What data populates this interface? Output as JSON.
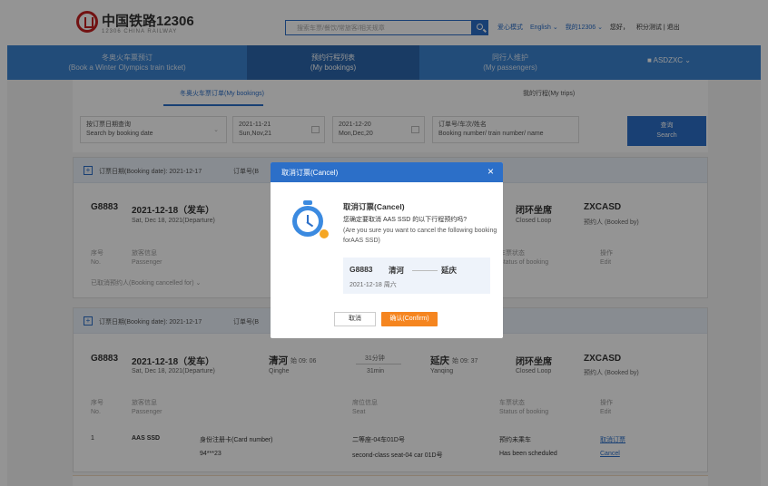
{
  "header": {
    "brand": "中国铁路12306",
    "brand_sub": "12306 CHINA RAILWAY",
    "search_placeholder": "搜索车票/餐饮/常旅客/相关规章",
    "links": [
      "爱心模式",
      "English ⌄",
      "我的12306 ⌄",
      "您好，"
    ],
    "user_links": "积分测试 | 退出"
  },
  "nav": {
    "items": [
      {
        "line1": "冬奥火车票预订",
        "line2": "(Book a Winter Olympics train ticket)"
      },
      {
        "line1": "预约行程列表",
        "line2": "(My bookings)"
      },
      {
        "line1": "同行人维护",
        "line2": "(My passengers)"
      }
    ],
    "user": "ASDZXC ⌄"
  },
  "tabs": {
    "tab1": "冬奥火车票订单(My bookings)",
    "tab2": "我的行程(My trips)"
  },
  "filter": {
    "type_line1": "按订票日期查询",
    "type_line2": "Search by booking date",
    "from_line1": "2021-11-21",
    "from_line2": "Sun,Nov,21",
    "to_line1": "2021-12-20",
    "to_line2": "Mon,Dec,20",
    "keyword_line1": "订单号/车次/姓名",
    "keyword_line2": "Booking number/ train number/ name",
    "query_line1": "查询",
    "query_line2": "Search"
  },
  "card1": {
    "booking_date": "订票日期(Booking date):  2021-12-17",
    "order_label": "订单号(B",
    "train": "G8883",
    "date": "2021-12-18（发车）",
    "date_en": "Sat,  Dec  18,  2021(Departure)",
    "seat_type": "闭环坐席",
    "seat_type_en": "Closed Loop",
    "booker": "ZXCASD",
    "booker_label": "预约人 (Booked by)",
    "col_no": "序号",
    "col_no_en": "No.",
    "col_passenger": "旅客信息",
    "col_passenger_en": "Passenger",
    "col_status": "车票状态",
    "col_status_en": "Status of booking",
    "col_action": "操作",
    "col_action_en": "Edit",
    "cancelled_toggle": "已取消预约人(Booking cancelled for) ⌄"
  },
  "card2": {
    "booking_date": "订票日期(Booking date):  2021-12-17",
    "order_label": "订单号(B",
    "train": "G8883",
    "date": "2021-12-18（发车）",
    "date_en": "Sat,  Dec  18,  2021(Departure)",
    "from_station": "清河",
    "from_time": "始 09: 06",
    "from_en": "Qinghe",
    "duration": "31分钟",
    "duration_en": "31min",
    "to_station": "延庆",
    "to_time": "始 09: 37",
    "to_en": "Yanqing",
    "seat_type": "闭环坐席",
    "seat_type_en": "Closed Loop",
    "booker": "ZXCASD",
    "booker_label": "预约人 (Booked by)",
    "col_no": "序号",
    "col_no_en": "No.",
    "col_passenger": "旅客信息",
    "col_passenger_en": "Passenger",
    "col_seat": "席位信息",
    "col_seat_en": "Seat",
    "col_status": "车票状态",
    "col_status_en": "Status of booking",
    "col_action": "操作",
    "col_action_en": "Edit",
    "row": {
      "no": "1",
      "name": "AAS SSD",
      "id_label": "身份注册卡(Card number)",
      "id_value": "94***23",
      "seat": "二等座-04车01D号",
      "seat_en": "second-class seat-04 car 01D号",
      "status": "预约未乘车",
      "status_en": "Has been scheduled",
      "action": "取消订票",
      "action_en": "Cancel"
    }
  },
  "modal": {
    "header": "取消订票(Cancel)",
    "close": "×",
    "title": "取消订票(Cancel)",
    "question": "您确定要取消 AAS SSD 的以下行程预约吗?",
    "question_en": "(Are you sure you want to cancel the following booking forAAS SSD)",
    "train": "G8883",
    "from": "清河",
    "to": "延庆",
    "date": "2021-12-18 周六",
    "cancel_label": "取消",
    "confirm_label": "确认(Confirm)"
  },
  "colors": {
    "primary": "#2c6fc8",
    "nav_bg": "#3b83d0",
    "confirm": "#f5851f"
  }
}
